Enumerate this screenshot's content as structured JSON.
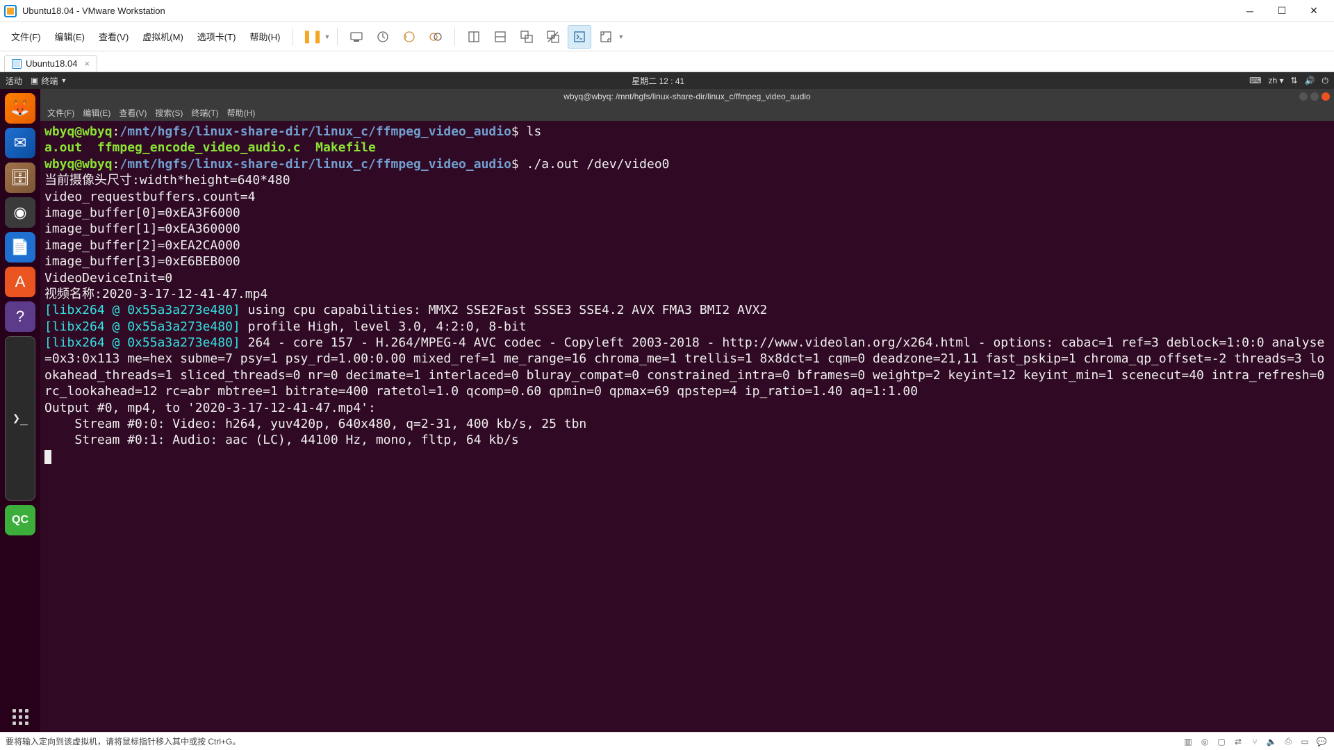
{
  "window": {
    "title": "Ubuntu18.04 - VMware Workstation"
  },
  "vmware_menu": {
    "file": "文件(F)",
    "edit": "编辑(E)",
    "view": "查看(V)",
    "vm": "虚拟机(M)",
    "tabs": "选项卡(T)",
    "help": "帮助(H)"
  },
  "vm_tab": {
    "label": "Ubuntu18.04"
  },
  "ubuntu_top": {
    "activities": "活动",
    "terminal_label": "终端",
    "clock": "星期二 12 : 41",
    "lang": "zh"
  },
  "term_window": {
    "title": "wbyq@wbyq: /mnt/hgfs/linux-share-dir/linux_c/ffmpeg_video_audio"
  },
  "term_menu": {
    "file": "文件(F)",
    "edit": "编辑(E)",
    "view": "查看(V)",
    "search": "搜索(S)",
    "terminal": "终端(T)",
    "help": "帮助(H)"
  },
  "term": {
    "prompt_user": "wbyq@wbyq",
    "prompt_path": "/mnt/hgfs/linux-share-dir/linux_c/ffmpeg_video_audio",
    "cmd1": "ls",
    "ls_out": {
      "a": "a.out",
      "b": "ffmpeg_encode_video_audio.c",
      "c": "Makefile"
    },
    "cmd2": "./a.out /dev/video0",
    "line_cam": "当前摄像头尺寸:width*height=640*480",
    "line_vreq": "video_requestbuffers.count=4",
    "line_ib0": "image_buffer[0]=0xEA3F6000",
    "line_ib1": "image_buffer[1]=0xEA360000",
    "line_ib2": "image_buffer[2]=0xEA2CA000",
    "line_ib3": "image_buffer[3]=0xE6BEB000",
    "line_vdi": "VideoDeviceInit=0",
    "line_vname": "视频名称:2020-3-17-12-41-47.mp4",
    "libx_tag": "[libx264 @ 0x55a3a273e480]",
    "libx1": " using cpu capabilities: MMX2 SSE2Fast SSSE3 SSE4.2 AVX FMA3 BMI2 AVX2",
    "libx2": " profile High, level 3.0, 4:2:0, 8-bit",
    "libx3": " 264 - core 157 - H.264/MPEG-4 AVC codec - Copyleft 2003-2018 - http://www.videolan.org/x264.html - options: cabac=1 ref=3 deblock=1:0:0 analyse=0x3:0x113 me=hex subme=7 psy=1 psy_rd=1.00:0.00 mixed_ref=1 me_range=16 chroma_me=1 trellis=1 8x8dct=1 cqm=0 deadzone=21,11 fast_pskip=1 chroma_qp_offset=-2 threads=3 lookahead_threads=1 sliced_threads=0 nr=0 decimate=1 interlaced=0 bluray_compat=0 constrained_intra=0 bframes=0 weightp=2 keyint=12 keyint_min=1 scenecut=40 intra_refresh=0 rc_lookahead=12 rc=abr mbtree=1 bitrate=400 ratetol=1.0 qcomp=0.60 qpmin=0 qpmax=69 qpstep=4 ip_ratio=1.40 aq=1:1.00",
    "out_hdr": "Output #0, mp4, to '2020-3-17-12-41-47.mp4':",
    "out_s0": "    Stream #0:0: Video: h264, yuv420p, 640x480, q=2-31, 400 kb/s, 25 tbn",
    "out_s1": "    Stream #0:1: Audio: aac (LC), 44100 Hz, mono, fltp, 64 kb/s"
  },
  "statusbar": {
    "hint": "要将输入定向到该虚拟机，请将鼠标指针移入其中或按 Ctrl+G。"
  }
}
